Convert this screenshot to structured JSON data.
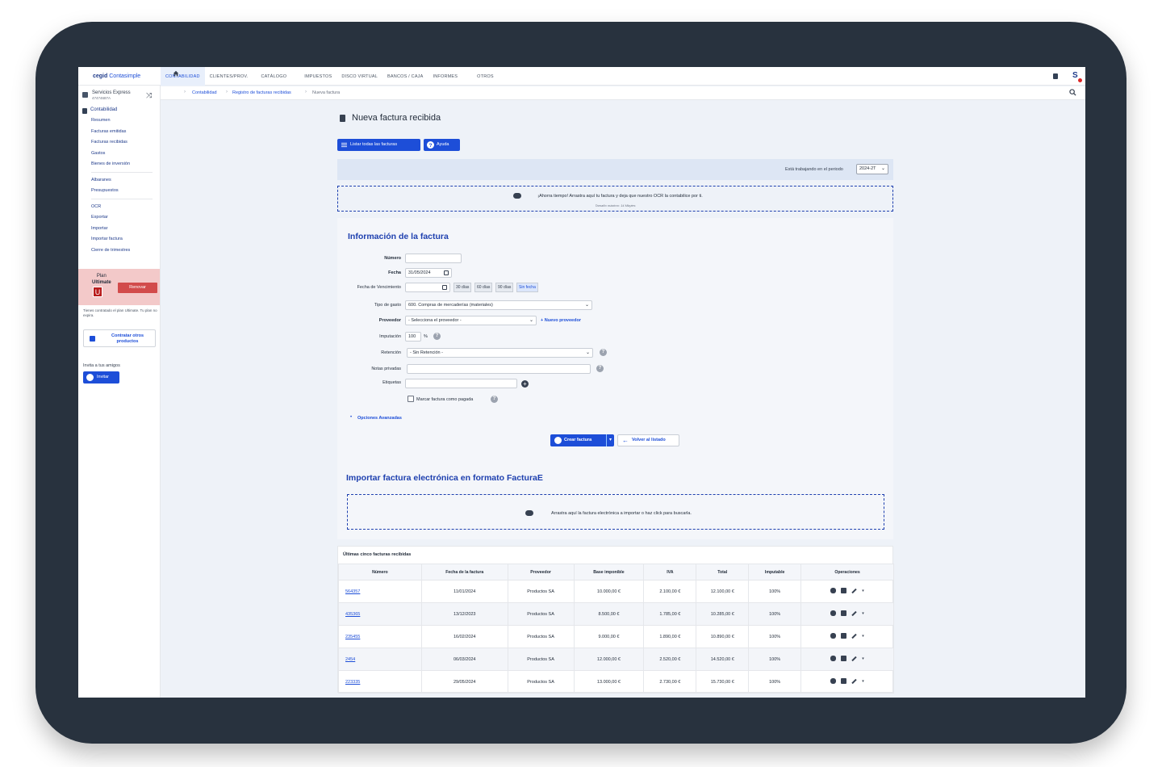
{
  "brand": {
    "prefix": "cegid",
    "name": "Contasimple"
  },
  "nav_tabs": [
    "CONTABILIDAD",
    "CLIENTES/PROV.",
    "CATÁLOGO",
    "IMPUESTOS",
    "DISCO VIRTUAL",
    "BANCOS / CAJA",
    "INFORMES",
    "OTROS"
  ],
  "user_avatar": "S",
  "breadcrumb": {
    "items": [
      "Contabilidad",
      "Registro de facturas recibidas",
      "Nueva factura"
    ]
  },
  "sidebar": {
    "company_name": "Servicios Express",
    "company_id": "47474687A",
    "section_title": "Contabilidad",
    "group1": [
      "Resumen",
      "Facturas emitidas",
      "Facturas recibidas",
      "Gastos",
      "Bienes de inversión"
    ],
    "group2": [
      "Albaranes",
      "Presupuestos"
    ],
    "group3": [
      "OCR",
      "Exportar",
      "Importar",
      "Importar factura",
      "Cierre de trimestres"
    ],
    "plan": {
      "label_line1": "Plan",
      "label_line2": "Ultimate",
      "badge": "U",
      "renew": "Renovar"
    },
    "plan_note": "Tienes contratado el plan Ultimate. Tu plan no expira.",
    "contract_button": "Contratar otros productos",
    "invite_label": "Invita a tus amigos",
    "invite_button": "Invitar"
  },
  "page": {
    "title": "Nueva factura recibida",
    "list_button": "Listar todas las facturas",
    "help_button": "Ayuda",
    "period_label": "Está trabajando en el periodo",
    "period_value": "2024-2T",
    "ocr_text": "¡Ahorra tiempo! Arrastra aquí tu factura y deja que nuestro OCR la contabilice por ti.",
    "ocr_subtext": "Tamaño máximo: 14 Mbytes"
  },
  "form": {
    "heading": "Información de la factura",
    "numero_label": "Número",
    "numero_value": "",
    "fecha_label": "Fecha",
    "fecha_value": "31/05/2024",
    "vencimiento_label": "Fecha de Vencimiento",
    "vencimiento_value": "",
    "due_options": [
      "30 días",
      "60 días",
      "90 días",
      "Sin fecha"
    ],
    "tipo_gasto_label": "Tipo de gasto",
    "tipo_gasto_value": "600. Compras de mercaderías (materiales)",
    "proveedor_label": "Proveedor",
    "proveedor_value": "- Selecciona el proveedor -",
    "nuevo_proveedor": "+ Nuevo proveedor",
    "imputacion_label": "Imputación",
    "imputacion_value": "100",
    "imputacion_unit": "%",
    "retencion_label": "Retención",
    "retencion_value": "- Sin Retención -",
    "notas_label": "Notas privadas",
    "notas_value": "",
    "etiquetas_label": "Etiquetas",
    "etiquetas_value": "",
    "pagada_label": "Marcar factura como pagada",
    "opciones_avanzadas": "Opciones Avanzadas",
    "create_button": "Crear factura",
    "back_button": "Volver al listado"
  },
  "efactura": {
    "heading": "Importar factura electrónica en formato FacturaE",
    "drop_text": "Arrastra aquí la factura electrónica a importar o haz click para buscarla."
  },
  "recent": {
    "title": "Últimas cinco facturas recibidas",
    "headers": [
      "Número",
      "Fecha de la factura",
      "Proveedor",
      "Base imponible",
      "IVA",
      "Total",
      "Imputable",
      "Operaciones"
    ],
    "rows": [
      [
        "564357",
        "11/01/2024",
        "Productos SA",
        "10.000,00 €",
        "2.100,00 €",
        "12.100,00 €",
        "100%"
      ],
      [
        "435365",
        "13/12/2023",
        "Productos SA",
        "8.500,00 €",
        "1.785,00 €",
        "10.285,00 €",
        "100%"
      ],
      [
        "235455",
        "16/02/2024",
        "Productos SA",
        "9.000,00 €",
        "1.890,00 €",
        "10.890,00 €",
        "100%"
      ],
      [
        "2454",
        "06/03/2024",
        "Productos SA",
        "12.000,00 €",
        "2.520,00 €",
        "14.520,00 €",
        "100%"
      ],
      [
        "223335",
        "29/05/2024",
        "Productos SA",
        "13.000,00 €",
        "2.730,00 €",
        "15.730,00 €",
        "100%"
      ]
    ]
  }
}
